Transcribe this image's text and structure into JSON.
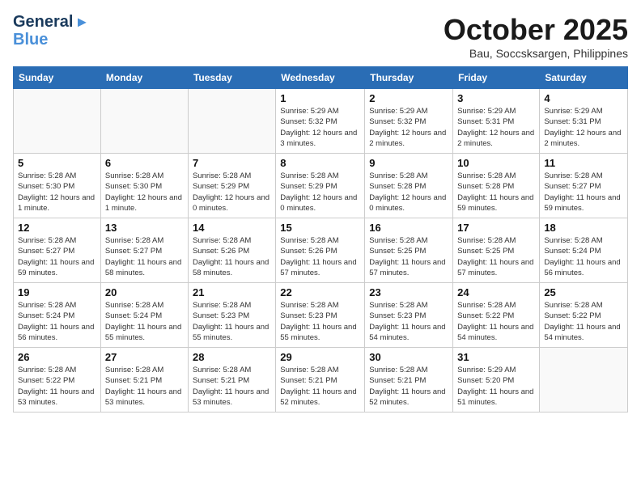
{
  "header": {
    "logo_line1": "General",
    "logo_line2": "Blue",
    "month": "October 2025",
    "location": "Bau, Soccsksargen, Philippines"
  },
  "weekdays": [
    "Sunday",
    "Monday",
    "Tuesday",
    "Wednesday",
    "Thursday",
    "Friday",
    "Saturday"
  ],
  "weeks": [
    [
      {
        "day": "",
        "info": ""
      },
      {
        "day": "",
        "info": ""
      },
      {
        "day": "",
        "info": ""
      },
      {
        "day": "1",
        "info": "Sunrise: 5:29 AM\nSunset: 5:32 PM\nDaylight: 12 hours and 3 minutes."
      },
      {
        "day": "2",
        "info": "Sunrise: 5:29 AM\nSunset: 5:32 PM\nDaylight: 12 hours and 2 minutes."
      },
      {
        "day": "3",
        "info": "Sunrise: 5:29 AM\nSunset: 5:31 PM\nDaylight: 12 hours and 2 minutes."
      },
      {
        "day": "4",
        "info": "Sunrise: 5:29 AM\nSunset: 5:31 PM\nDaylight: 12 hours and 2 minutes."
      }
    ],
    [
      {
        "day": "5",
        "info": "Sunrise: 5:28 AM\nSunset: 5:30 PM\nDaylight: 12 hours and 1 minute."
      },
      {
        "day": "6",
        "info": "Sunrise: 5:28 AM\nSunset: 5:30 PM\nDaylight: 12 hours and 1 minute."
      },
      {
        "day": "7",
        "info": "Sunrise: 5:28 AM\nSunset: 5:29 PM\nDaylight: 12 hours and 0 minutes."
      },
      {
        "day": "8",
        "info": "Sunrise: 5:28 AM\nSunset: 5:29 PM\nDaylight: 12 hours and 0 minutes."
      },
      {
        "day": "9",
        "info": "Sunrise: 5:28 AM\nSunset: 5:28 PM\nDaylight: 12 hours and 0 minutes."
      },
      {
        "day": "10",
        "info": "Sunrise: 5:28 AM\nSunset: 5:28 PM\nDaylight: 11 hours and 59 minutes."
      },
      {
        "day": "11",
        "info": "Sunrise: 5:28 AM\nSunset: 5:27 PM\nDaylight: 11 hours and 59 minutes."
      }
    ],
    [
      {
        "day": "12",
        "info": "Sunrise: 5:28 AM\nSunset: 5:27 PM\nDaylight: 11 hours and 59 minutes."
      },
      {
        "day": "13",
        "info": "Sunrise: 5:28 AM\nSunset: 5:27 PM\nDaylight: 11 hours and 58 minutes."
      },
      {
        "day": "14",
        "info": "Sunrise: 5:28 AM\nSunset: 5:26 PM\nDaylight: 11 hours and 58 minutes."
      },
      {
        "day": "15",
        "info": "Sunrise: 5:28 AM\nSunset: 5:26 PM\nDaylight: 11 hours and 57 minutes."
      },
      {
        "day": "16",
        "info": "Sunrise: 5:28 AM\nSunset: 5:25 PM\nDaylight: 11 hours and 57 minutes."
      },
      {
        "day": "17",
        "info": "Sunrise: 5:28 AM\nSunset: 5:25 PM\nDaylight: 11 hours and 57 minutes."
      },
      {
        "day": "18",
        "info": "Sunrise: 5:28 AM\nSunset: 5:24 PM\nDaylight: 11 hours and 56 minutes."
      }
    ],
    [
      {
        "day": "19",
        "info": "Sunrise: 5:28 AM\nSunset: 5:24 PM\nDaylight: 11 hours and 56 minutes."
      },
      {
        "day": "20",
        "info": "Sunrise: 5:28 AM\nSunset: 5:24 PM\nDaylight: 11 hours and 55 minutes."
      },
      {
        "day": "21",
        "info": "Sunrise: 5:28 AM\nSunset: 5:23 PM\nDaylight: 11 hours and 55 minutes."
      },
      {
        "day": "22",
        "info": "Sunrise: 5:28 AM\nSunset: 5:23 PM\nDaylight: 11 hours and 55 minutes."
      },
      {
        "day": "23",
        "info": "Sunrise: 5:28 AM\nSunset: 5:23 PM\nDaylight: 11 hours and 54 minutes."
      },
      {
        "day": "24",
        "info": "Sunrise: 5:28 AM\nSunset: 5:22 PM\nDaylight: 11 hours and 54 minutes."
      },
      {
        "day": "25",
        "info": "Sunrise: 5:28 AM\nSunset: 5:22 PM\nDaylight: 11 hours and 54 minutes."
      }
    ],
    [
      {
        "day": "26",
        "info": "Sunrise: 5:28 AM\nSunset: 5:22 PM\nDaylight: 11 hours and 53 minutes."
      },
      {
        "day": "27",
        "info": "Sunrise: 5:28 AM\nSunset: 5:21 PM\nDaylight: 11 hours and 53 minutes."
      },
      {
        "day": "28",
        "info": "Sunrise: 5:28 AM\nSunset: 5:21 PM\nDaylight: 11 hours and 53 minutes."
      },
      {
        "day": "29",
        "info": "Sunrise: 5:28 AM\nSunset: 5:21 PM\nDaylight: 11 hours and 52 minutes."
      },
      {
        "day": "30",
        "info": "Sunrise: 5:28 AM\nSunset: 5:21 PM\nDaylight: 11 hours and 52 minutes."
      },
      {
        "day": "31",
        "info": "Sunrise: 5:29 AM\nSunset: 5:20 PM\nDaylight: 11 hours and 51 minutes."
      },
      {
        "day": "",
        "info": ""
      }
    ]
  ]
}
